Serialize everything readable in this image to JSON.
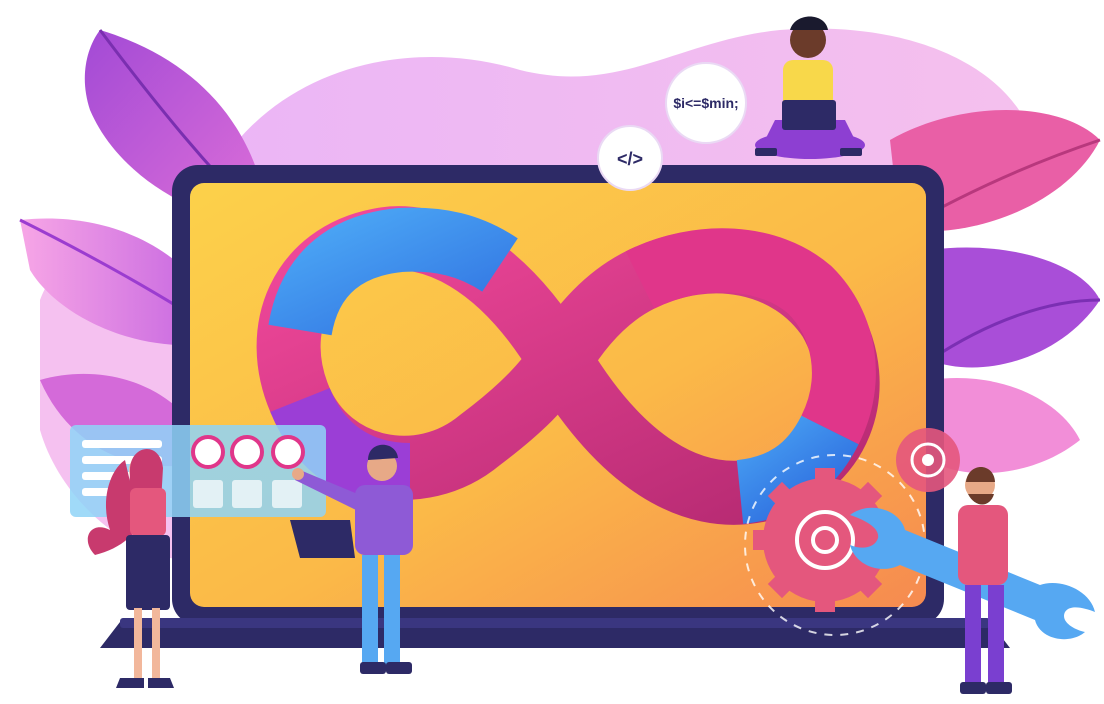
{
  "bubbles": {
    "code_tag": "</>",
    "php_snippet": "$i<=$min;"
  },
  "icons": [
    "infinity-loop-icon",
    "code-tag-icon",
    "gear-icon",
    "wrench-icon",
    "laptop-icon",
    "dashboard-panel-icon"
  ],
  "colors": {
    "screen_yellow": "#fbc544",
    "screen_orange": "#f79a4d",
    "laptop_frame": "#2d2a66",
    "loop_blue": "#3d8ff2",
    "loop_magenta": "#d6317f",
    "loop_purple": "#8e3bd6",
    "leaf_purple": "#b35adb",
    "leaf_pink": "#f07ad1",
    "gear_pink": "#e4577d",
    "wrench_blue": "#56a8f2"
  }
}
